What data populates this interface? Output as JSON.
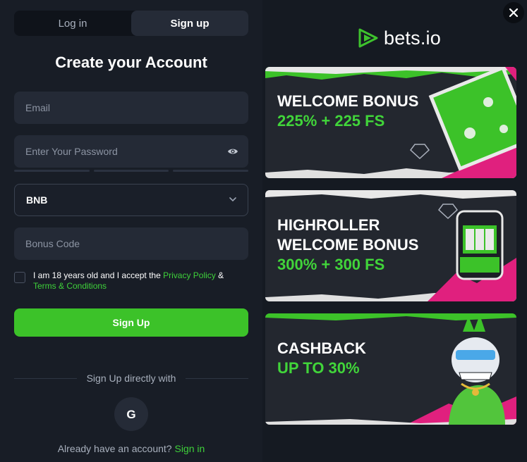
{
  "tabs": [
    {
      "label": "Log in",
      "active": false
    },
    {
      "label": "Sign up",
      "active": true
    }
  ],
  "title": "Create your Account",
  "fields": {
    "email_placeholder": "Email",
    "password_placeholder": "Enter Your Password",
    "currency_value": "BNB",
    "bonus_placeholder": "Bonus Code"
  },
  "consent": {
    "prefix": "I am 18 years old and I accept the ",
    "privacy_link": "Privacy Policy",
    "amp": " & ",
    "terms_link": "Terms & Conditions"
  },
  "signup_button": "Sign Up",
  "divider_text": "Sign Up directly with",
  "google_icon_letter": "G",
  "already": {
    "text": "Already have an account?",
    "link": "Sign in"
  },
  "brand": {
    "name": "bets.io",
    "accent": "#3ec22d"
  },
  "banners": [
    {
      "line1": "WELCOME BONUS",
      "line2": "225% + 225 FS"
    },
    {
      "line1": "HIGHROLLER",
      "line2": "WELCOME BONUS",
      "line3": "300% + 300 FS"
    },
    {
      "line1": "CASHBACK",
      "line2": "UP TO 30%"
    }
  ],
  "colors": {
    "accent_green": "#3cc229",
    "link_green": "#3ed13a",
    "pink": "#e0207e"
  }
}
